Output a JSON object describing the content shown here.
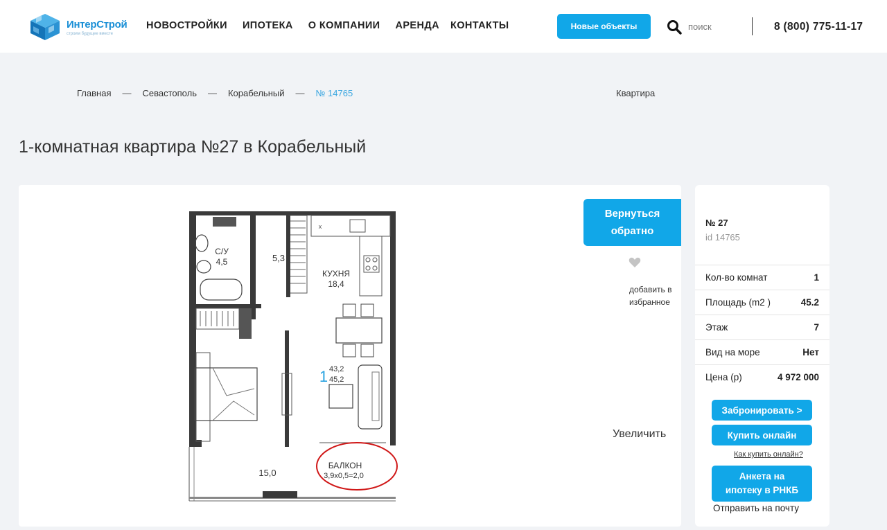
{
  "header": {
    "logo": {
      "name": "ИнтерСтрой",
      "tagline": "строим будущее вместе"
    },
    "nav": [
      "НОВОСТРОЙКИ",
      "ИПОТЕКА",
      "О КОМПАНИИ",
      "АРЕНДА",
      "КОНТАКТЫ"
    ],
    "new_objects_button": "Новые объекты",
    "search_label": "поиск",
    "phone": "8 (800) 775-11-17"
  },
  "breadcrumbs": {
    "items": [
      "Главная",
      "Севастополь",
      "Корабельный",
      "№ 14765"
    ],
    "separator": "—",
    "type_label": "Квартира"
  },
  "page_title": "1-комнатная квартира №27 в Корабельный",
  "plan": {
    "bathroom": "С/У",
    "bathroom_area": "4,5",
    "hall_area": "5,3",
    "kitchen": "КУХНЯ",
    "kitchen_area": "18,4",
    "rooms": "1",
    "living_area": "43,2",
    "total_area": "45,2",
    "room_area": "15,0",
    "balcony": "БАЛКОН",
    "balcony_dims": "3,9x0,5=2,0"
  },
  "actions": {
    "back_button_line1": "Вернуться",
    "back_button_line2": "обратно",
    "favorite_line1": "добавить в",
    "favorite_line2": "избранное",
    "zoom": "Увеличить"
  },
  "side": {
    "number": "№ 27",
    "id": "id 14765",
    "params": [
      {
        "label": "Кол-во комнат",
        "value": "1"
      },
      {
        "label": "Площадь (m2 )",
        "value": "45.2"
      },
      {
        "label": "Этаж",
        "value": "7"
      },
      {
        "label": "Вид на море",
        "value": "Нет"
      },
      {
        "label": "Цена (р)",
        "value": "4 972 000"
      }
    ],
    "book_button": "Забронировать >",
    "buy_button": "Купить онлайн",
    "how_to_buy": "Как купить онлайн?",
    "mortgage_line1": "Анкета на",
    "mortgage_line2": "ипотеку в РНКБ",
    "send_mail": "Отправить на почту"
  },
  "colors": {
    "accent": "#11a7e8",
    "link": "#3aa6e0",
    "balcony_marker": "#d01818"
  }
}
